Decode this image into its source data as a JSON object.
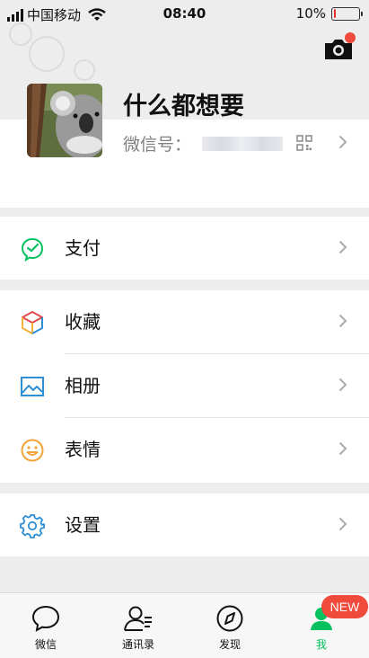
{
  "status_bar": {
    "carrier": "中国移动",
    "time": "08:40",
    "battery_percent": "10%",
    "battery_level": 0.1
  },
  "profile": {
    "nickname": "什么都想要",
    "wechat_id_label": "微信号：",
    "wechat_id_value": ""
  },
  "menu": {
    "pay": {
      "label": "支付",
      "icon": "wechat-pay-icon"
    },
    "favorites": {
      "label": "收藏",
      "icon": "cube-icon"
    },
    "album": {
      "label": "相册",
      "icon": "picture-icon"
    },
    "stickers": {
      "label": "表情",
      "icon": "smiley-icon"
    },
    "settings": {
      "label": "设置",
      "icon": "gear-icon"
    }
  },
  "tabbar": {
    "tabs": [
      {
        "label": "微信",
        "icon": "chat-bubble-icon",
        "active": false
      },
      {
        "label": "通讯录",
        "icon": "contacts-icon",
        "active": false
      },
      {
        "label": "发现",
        "icon": "compass-icon",
        "active": false
      },
      {
        "label": "我",
        "icon": "person-icon",
        "active": true
      }
    ],
    "new_badge": "NEW"
  },
  "colors": {
    "accent": "#07c160",
    "badge": "#f04a3c",
    "background": "#ededed",
    "pay_icon": "#07c160",
    "album_icon": "#2e8fd6",
    "stickers_icon": "#f3a33b",
    "settings_icon": "#2e8fd6"
  }
}
